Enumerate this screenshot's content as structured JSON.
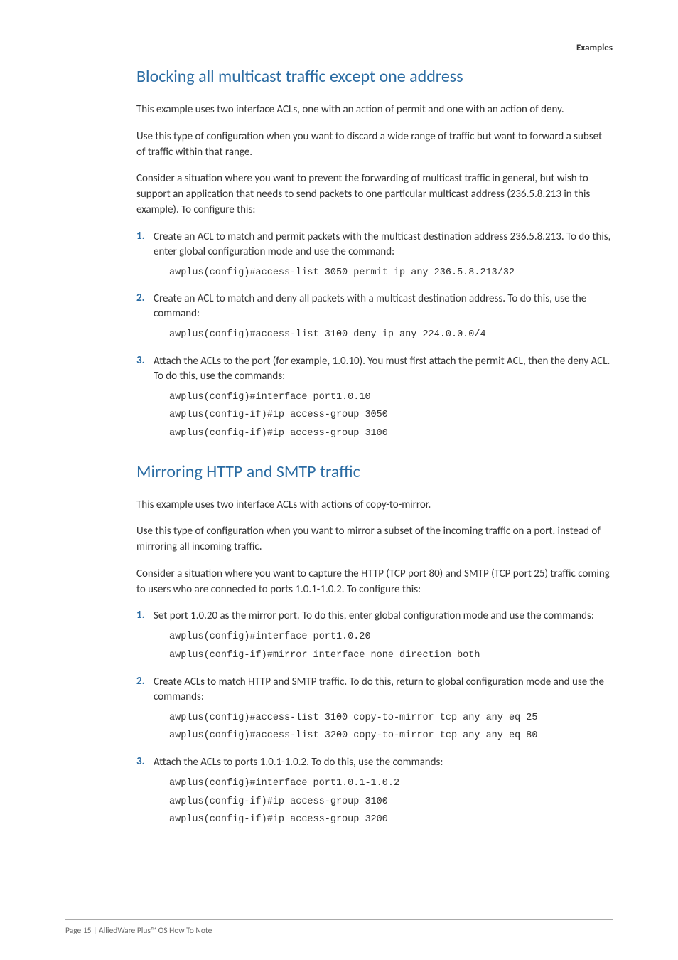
{
  "header": {
    "section": "Examples"
  },
  "s1": {
    "title": "Blocking all multicast traffic except one address",
    "p1": "This example uses two interface ACLs, one with an action of permit and one with an action of deny.",
    "p2": "Use this type of configuration when you want to discard a wide range of traffic but want to forward a subset of traffic within that range.",
    "p3": "Consider a situation where you want to prevent the forwarding of multicast traffic in general, but wish to support an application that needs to send packets to one particular multicast address (236.5.8.213 in this example). To configure this:",
    "step1": {
      "n": "1.",
      "t": "Create an ACL to match and permit packets with the multicast destination address 236.5.8.213. To do this, enter global configuration mode and use the command:",
      "c": "awplus(config)#access-list 3050 permit ip any 236.5.8.213/32"
    },
    "step2": {
      "n": "2.",
      "t": "Create an ACL to match and deny all packets with a multicast destination address. To do this, use the command:",
      "c": "awplus(config)#access-list 3100 deny ip any 224.0.0.0/4"
    },
    "step3": {
      "n": "3.",
      "t": "Attach the ACLs to the port (for example, 1.0.10). You must first attach the permit ACL, then the deny ACL. To do this, use the commands:",
      "c": "awplus(config)#interface port1.0.10\nawplus(config-if)#ip access-group 3050\nawplus(config-if)#ip access-group 3100"
    }
  },
  "s2": {
    "title": "Mirroring HTTP and SMTP traffic",
    "p1": "This example uses two interface ACLs with actions of copy-to-mirror.",
    "p2": "Use this type of configuration when you want to mirror a subset of the incoming traffic on a port, instead of mirroring all incoming traffic.",
    "p3": "Consider a situation where you want to capture the HTTP (TCP port 80) and SMTP (TCP port 25) traffic coming to users who are connected to ports 1.0.1-1.0.2. To configure this:",
    "step1": {
      "n": "1.",
      "t": "Set port 1.0.20 as the mirror port. To do this, enter global configuration mode and use the commands:",
      "c": "awplus(config)#interface port1.0.20\nawplus(config-if)#mirror interface none direction both"
    },
    "step2": {
      "n": "2.",
      "t": "Create ACLs to match HTTP and SMTP traffic. To do this, return to global configuration mode and use the commands:",
      "c": "awplus(config)#access-list 3100 copy-to-mirror tcp any any eq 25\nawplus(config)#access-list 3200 copy-to-mirror tcp any any eq 80"
    },
    "step3": {
      "n": "3.",
      "t": "Attach the ACLs to ports 1.0.1-1.0.2. To do this, use the commands:",
      "c": "awplus(config)#interface port1.0.1-1.0.2\nawplus(config-if)#ip access-group 3100\nawplus(config-if)#ip access-group 3200"
    }
  },
  "footer": {
    "text": "Page 15 | AlliedWare Plus™ OS How To Note"
  }
}
